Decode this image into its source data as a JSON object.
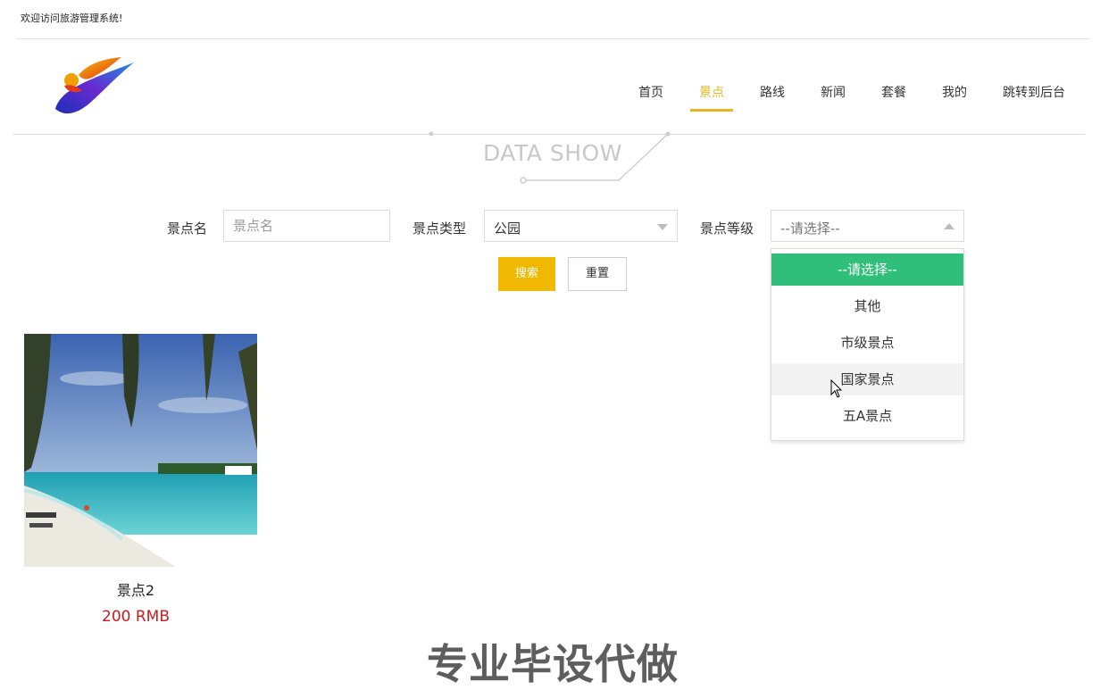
{
  "topbar": {
    "welcome": "欢迎访问旅游管理系统!"
  },
  "nav": {
    "items": [
      {
        "label": "首页",
        "active": false
      },
      {
        "label": "景点",
        "active": true
      },
      {
        "label": "路线",
        "active": false
      },
      {
        "label": "新闻",
        "active": false
      },
      {
        "label": "套餐",
        "active": false
      },
      {
        "label": "我的",
        "active": false
      },
      {
        "label": "跳转到后台",
        "active": false
      }
    ],
    "accent_color": "#e9b420"
  },
  "section_heading": "DATA SHOW",
  "filters": {
    "name_label": "景点名",
    "name_placeholder": "景点名",
    "type_label": "景点类型",
    "type_value": "公园",
    "level_label": "景点等级",
    "level_value": "--请选择--"
  },
  "buttons": {
    "search": "搜索",
    "reset": "重置",
    "search_color": "#f1b800"
  },
  "level_dropdown": {
    "options": [
      "--请选择--",
      "其他",
      "市级景点",
      "国家景点",
      "五A景点"
    ],
    "selected_index": 0,
    "hover_index": 3,
    "selected_color": "#2fbf7a"
  },
  "cards": [
    {
      "name": "景点2",
      "price": "200 RMB"
    }
  ],
  "watermark": "专业毕设代做"
}
